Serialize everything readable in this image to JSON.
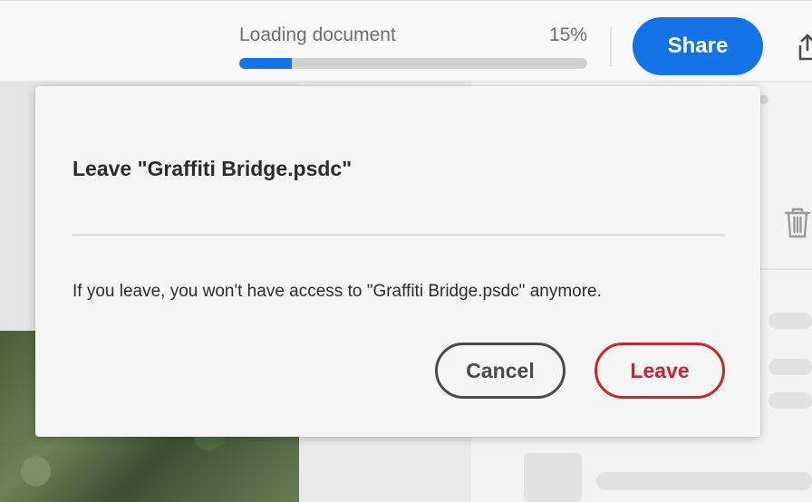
{
  "topbar": {
    "progress_label": "Loading document",
    "progress_percent_text": "15%",
    "progress_fraction": 0.15,
    "share_label": "Share",
    "accent_color": "#1473e6"
  },
  "dialog": {
    "title": "Leave \"Graffiti Bridge.psdc\"",
    "body": "If you leave, you won't have access to \"Graffiti Bridge.psdc\" anymore.",
    "cancel_label": "Cancel",
    "leave_label": "Leave",
    "danger_color": "#c9252d"
  },
  "icons": {
    "export": "export-icon",
    "trash": "trash-icon"
  }
}
